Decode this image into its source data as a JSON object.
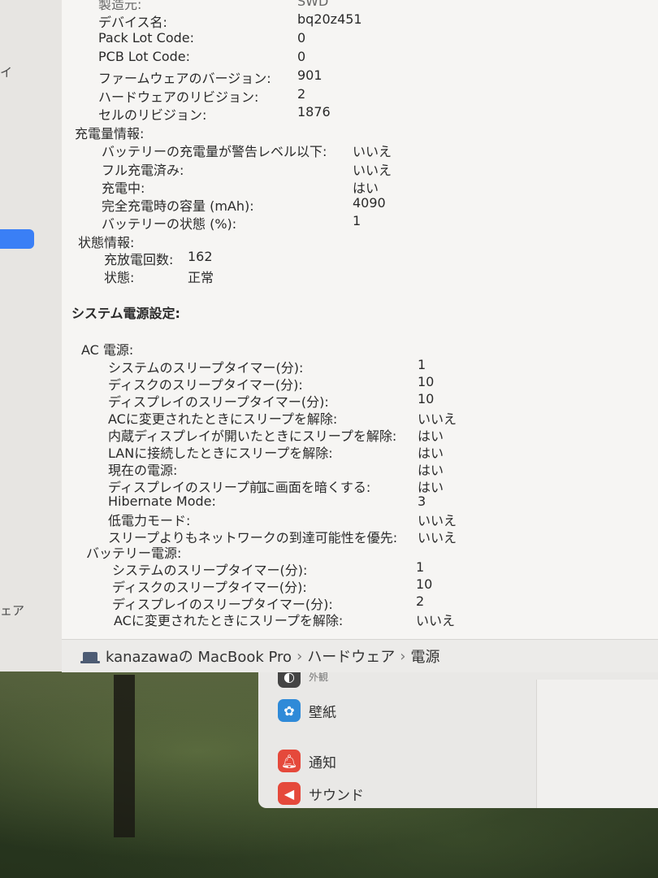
{
  "sidebar": {
    "frag_top": "イ",
    "frag_bottom": "ェア"
  },
  "battery_model": {
    "cut_label": "製造元:",
    "cut_value": "SWD",
    "rows": [
      {
        "label": "デバイス名:",
        "value": "bq20z451"
      },
      {
        "label": "Pack Lot Code:",
        "value": "0"
      },
      {
        "label": "PCB Lot Code:",
        "value": "0"
      },
      {
        "label": "ファームウェアのバージョン:",
        "value": "901"
      },
      {
        "label": "ハードウェアのリビジョン:",
        "value": "2"
      },
      {
        "label": "セルのリビジョン:",
        "value": "1876"
      }
    ]
  },
  "charge_info": {
    "heading": "充電量情報:",
    "rows": [
      {
        "label": "バッテリーの充電量が警告レベル以下:",
        "value": "いいえ"
      },
      {
        "label": "フル充電済み:",
        "value": "いいえ"
      },
      {
        "label": "充電中:",
        "value": "はい"
      },
      {
        "label": "完全充電時の容量 (mAh):",
        "value": "4090"
      },
      {
        "label": "バッテリーの状態 (%):",
        "value": "1"
      }
    ]
  },
  "health_info": {
    "heading": "状態情報:",
    "rows": [
      {
        "label": "充放電回数:",
        "value": "162"
      },
      {
        "label": "状態:",
        "value": "正常"
      }
    ]
  },
  "power_settings": {
    "heading": "システム電源設定:",
    "ac": {
      "heading": "AC 電源:",
      "rows": [
        {
          "label": "システムのスリープタイマー(分):",
          "value": "1"
        },
        {
          "label": "ディスクのスリープタイマー(分):",
          "value": "10"
        },
        {
          "label": "ディスプレイのスリープタイマー(分):",
          "value": "10"
        },
        {
          "label": "ACに変更されたときにスリープを解除:",
          "value": "いいえ"
        },
        {
          "label": "内蔵ディスプレイが開いたときにスリープを解除:",
          "value": "はい"
        },
        {
          "label": "LANに接続したときにスリープを解除:",
          "value": "はい"
        },
        {
          "label": "現在の電源:",
          "value": "はい"
        },
        {
          "label": "ディスプレイのスリープ前に画面を暗くする:",
          "value": "はい"
        },
        {
          "label": "Hibernate Mode:",
          "value": "3"
        },
        {
          "label": "低電力モード:",
          "value": "いいえ"
        },
        {
          "label": "スリープよりもネットワークの到達可能性を優先:",
          "value": "いいえ"
        }
      ]
    },
    "battery": {
      "heading": "バッテリー電源:",
      "rows": [
        {
          "label": "システムのスリープタイマー(分):",
          "value": "1"
        },
        {
          "label": "ディスクのスリープタイマー(分):",
          "value": "10"
        },
        {
          "label": "ディスプレイのスリープタイマー(分):",
          "value": "2"
        },
        {
          "label": "ACに変更されたときにスリープを解除:",
          "value": "いいえ"
        }
      ]
    }
  },
  "pathbar": {
    "crumbs": [
      "kanazawaの MacBook Pro",
      "ハードウェア",
      "電源"
    ],
    "separator": "›"
  },
  "settings_window": {
    "items": [
      {
        "label": "壁紙",
        "icon": "wallpaper-icon",
        "color": "#2f8ad8"
      },
      {
        "label": "通知",
        "icon": "bell-icon",
        "color": "#e5493b"
      },
      {
        "label": "サウンド",
        "icon": "speaker-icon",
        "color": "#e5493b"
      }
    ],
    "cut_item": "外観"
  }
}
